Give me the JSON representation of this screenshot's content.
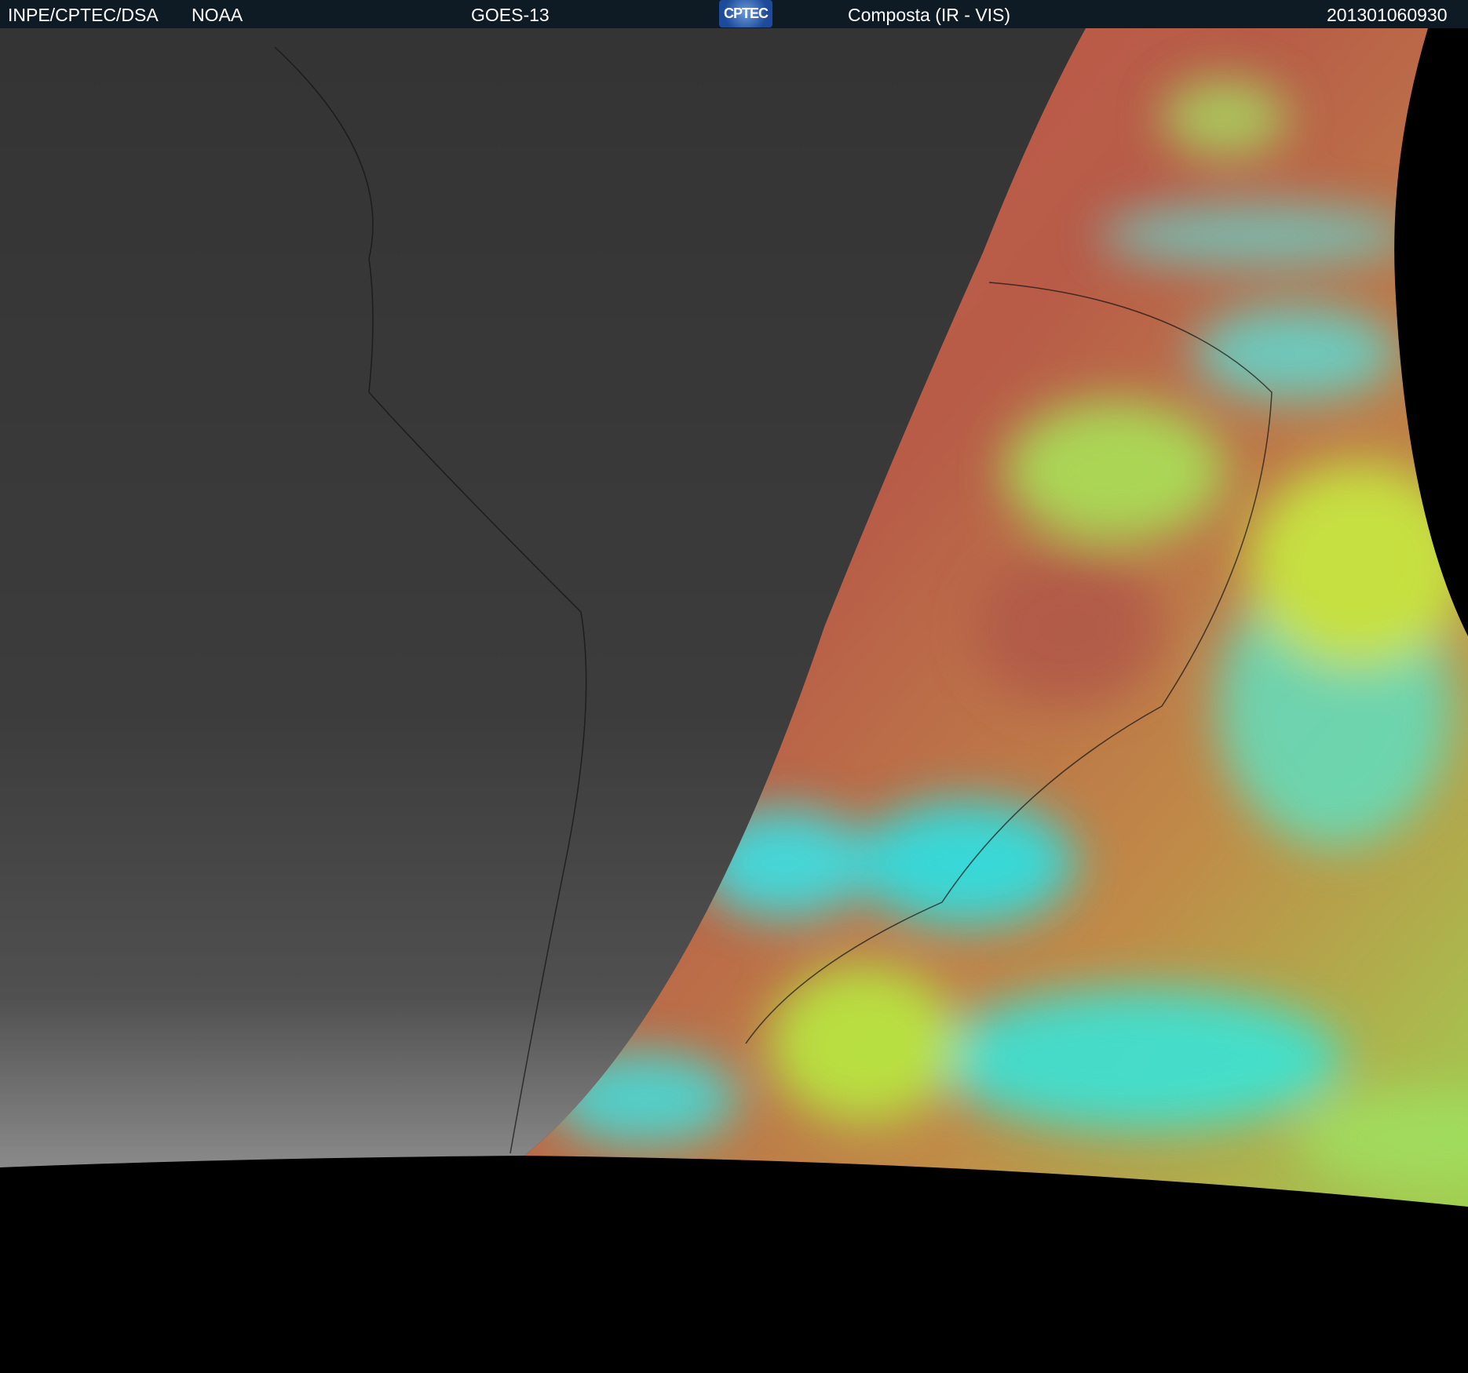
{
  "header": {
    "agency": "INPE/CPTEC/DSA",
    "partner": "NOAA",
    "satellite": "GOES-13",
    "logo_text": "CPTEC",
    "product": "Composta (IR - VIS)",
    "timestamp": "201301060930"
  },
  "colors": {
    "header_bg": "#0f1b24",
    "night_gray": "#3a3a3a",
    "day_red": "#b0584a",
    "day_green": "#b8f04a",
    "day_cyan": "#20e8f0"
  }
}
